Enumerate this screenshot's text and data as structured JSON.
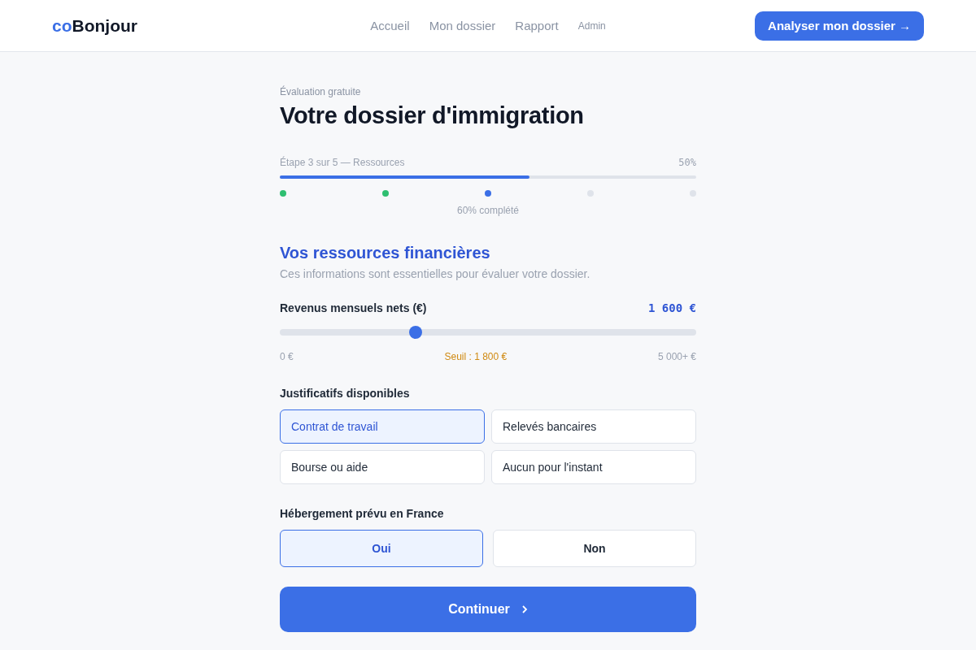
{
  "header": {
    "logo": {
      "accent": "co",
      "text": "Bonjour"
    },
    "nav": [
      {
        "label": "Accueil",
        "kind": "main"
      },
      {
        "label": "Mon dossier",
        "kind": "main"
      },
      {
        "label": "Rapport",
        "kind": "main"
      },
      {
        "label": "Admin",
        "kind": "minor"
      }
    ],
    "cta": "Analyser mon dossier →"
  },
  "intro": {
    "eyebrow": "Évaluation gratuite",
    "title": "Votre dossier d'immigration"
  },
  "progress": {
    "step_label": "Étape 3 sur 5 — Ressources",
    "percent": "50%",
    "level": 0.6,
    "steps": [
      {
        "done": true,
        "current": false
      },
      {
        "done": true,
        "current": false
      },
      {
        "done": false,
        "current": true
      },
      {
        "done": false,
        "current": false
      },
      {
        "done": false,
        "current": false
      }
    ],
    "caption": "60% complété"
  },
  "section": {
    "title": "Vos ressources financières",
    "subtitle": "Ces informations sont essentielles pour évaluer votre dossier."
  },
  "income": {
    "label": "Revenus mensuels nets (€)",
    "value": "1 600 €",
    "level": 0.326,
    "min": "0 €",
    "threshold": "Seuil : 1 800 €",
    "max": "5 000+ €"
  },
  "documents": {
    "label": "Justificatifs disponibles",
    "options": [
      {
        "label": "Contrat de travail",
        "selected": true
      },
      {
        "label": "Relevés bancaires",
        "selected": false
      },
      {
        "label": "Bourse ou aide",
        "selected": false
      },
      {
        "label": "Aucun pour l'instant",
        "selected": false
      }
    ]
  },
  "housing": {
    "label": "Hébergement prévu en France",
    "options": [
      {
        "label": "Oui",
        "selected": true
      },
      {
        "label": "Non",
        "selected": false
      }
    ]
  },
  "continue": "Continuer"
}
